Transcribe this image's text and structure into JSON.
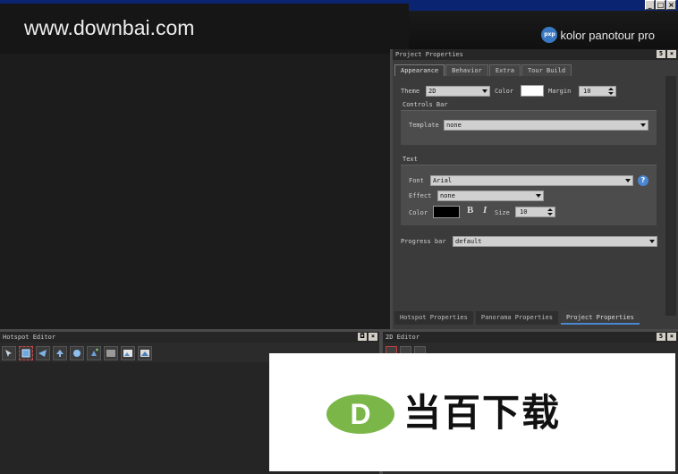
{
  "window": {
    "buttons": [
      "_",
      "□",
      "×"
    ]
  },
  "brand_logo": {
    "badge": "pxp",
    "text": "kolor panotour pro"
  },
  "watermark": {
    "site": "www.downbai.com",
    "brand_letter": "D",
    "brand_text": "当百下载",
    "brand_color": "#7ab648"
  },
  "project_properties": {
    "title": "Project Properties",
    "title_buttons": [
      "5",
      "×"
    ],
    "tabs": [
      {
        "label": "Appearance",
        "active": true
      },
      {
        "label": "Behavior",
        "active": false
      },
      {
        "label": "Extra",
        "active": false
      },
      {
        "label": "Tour Build",
        "active": false
      }
    ],
    "theme": {
      "label": "Theme",
      "value": "2D"
    },
    "color": {
      "label": "Color",
      "value": "#ffffff"
    },
    "margin": {
      "label": "Margin",
      "value": "10"
    },
    "controls_bar": {
      "title": "Controls Bar",
      "template_label": "Template",
      "template_value": "none"
    },
    "text": {
      "title": "Text",
      "font_label": "Font",
      "font_value": "Arial",
      "effect_label": "Effect",
      "effect_value": "none",
      "color_label": "Color",
      "color_value": "#000000",
      "bold": "B",
      "italic": "I",
      "size_label": "Size",
      "size_value": "10"
    },
    "progress_bar": {
      "label": "Progress bar",
      "value": "default"
    },
    "bottom_tabs": [
      {
        "label": "Hotspot Properties",
        "active": false
      },
      {
        "label": "Panorama Properties",
        "active": false
      },
      {
        "label": "Project Properties",
        "active": true
      }
    ]
  },
  "hotspot_editor": {
    "title": "Hotspot Editor",
    "title_buttons": [
      "◘",
      "×"
    ],
    "tools": [
      "select-hotspot-icon",
      "rect-hotspot-icon",
      "polygon-hotspot-icon",
      "arrow-hotspot-icon",
      "point-hotspot-icon",
      "add-point-icon",
      "image-hotspot-icon",
      "photo-hotspot-icon",
      "video-hotspot-icon"
    ]
  },
  "editor_2d": {
    "title": "2D Editor",
    "title_buttons": [
      "5",
      "×"
    ]
  }
}
